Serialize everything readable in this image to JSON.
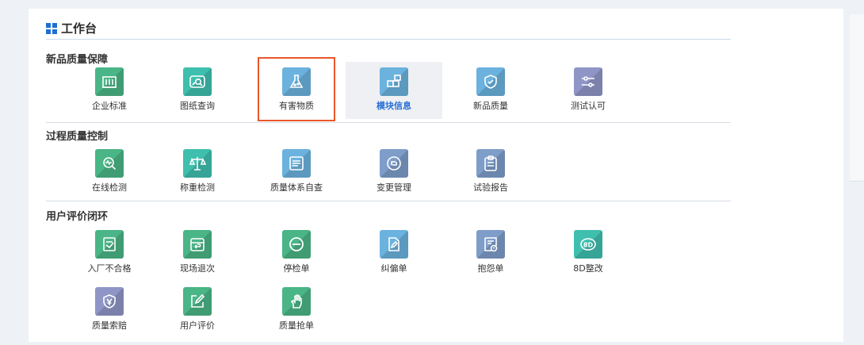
{
  "header": {
    "title": "工作台"
  },
  "colors": {
    "green": "#4ab586",
    "teal": "#3fbfae",
    "sky": "#6bb2de",
    "slate": "#7e9dc9",
    "purple": "#8f96c7",
    "highlight": "#e8572a",
    "active_text": "#2a6fd6"
  },
  "sections": [
    {
      "title": "新品质量保障",
      "items": [
        {
          "label": "企业标准",
          "icon": "building-icon"
        },
        {
          "label": "图纸查询",
          "icon": "picture-search-icon"
        },
        {
          "label": "有害物质",
          "icon": "flask-icon"
        },
        {
          "label": "模块信息",
          "icon": "modules-icon"
        },
        {
          "label": "新品质量",
          "icon": "shield-check-icon"
        },
        {
          "label": "测试认可",
          "icon": "sliders-icon"
        }
      ]
    },
    {
      "title": "过程质量控制",
      "items": [
        {
          "label": "在线检测",
          "icon": "pulse-search-icon"
        },
        {
          "label": "称重检测",
          "icon": "scale-icon"
        },
        {
          "label": "质量体系自查",
          "icon": "document-list-icon"
        },
        {
          "label": "变更管理",
          "icon": "refresh-circle-icon"
        },
        {
          "label": "试验报告",
          "icon": "clipboard-icon"
        }
      ]
    },
    {
      "title": "用户评价闭环",
      "items": [
        {
          "label": "入厂不合格",
          "icon": "edit-document-icon"
        },
        {
          "label": "现场退次",
          "icon": "return-box-icon"
        },
        {
          "label": "停检单",
          "icon": "stop-circle-icon"
        },
        {
          "label": "纠偏单",
          "icon": "edit-file-icon"
        },
        {
          "label": "抱怨单",
          "icon": "complaint-doc-icon"
        },
        {
          "label": "8D整改",
          "icon": "8d-icon"
        },
        {
          "label": "质量索赔",
          "icon": "yen-shield-icon"
        },
        {
          "label": "用户评价",
          "icon": "pencil-square-icon"
        },
        {
          "label": "质量抢单",
          "icon": "hand-grab-icon"
        }
      ]
    }
  ]
}
